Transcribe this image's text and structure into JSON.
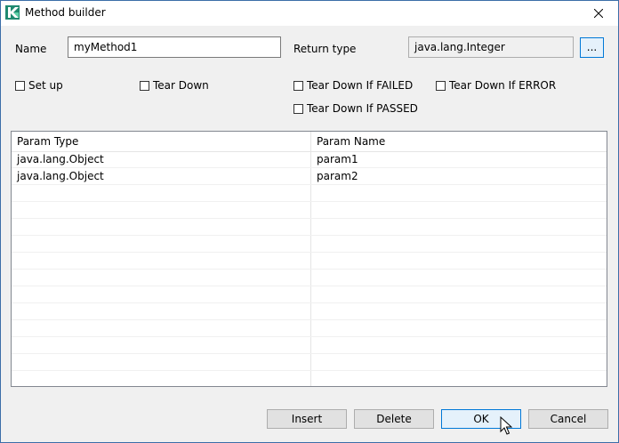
{
  "window": {
    "title": "Method builder"
  },
  "form": {
    "name_label": "Name",
    "name_value": "myMethod1",
    "return_label": "Return type",
    "return_value": "java.lang.Integer",
    "browse_label": "..."
  },
  "checkboxes": [
    {
      "label": "Set up",
      "checked": false
    },
    {
      "label": "Tear Down",
      "checked": false
    },
    {
      "label": "Tear Down If FAILED",
      "checked": false
    },
    {
      "label": "Tear Down If ERROR",
      "checked": false
    },
    {
      "label": "Tear Down If PASSED",
      "checked": false
    }
  ],
  "table": {
    "headers": [
      "Param Type",
      "Param Name"
    ],
    "rows": [
      [
        "java.lang.Object",
        "param1"
      ],
      [
        "java.lang.Object",
        "param2"
      ]
    ]
  },
  "buttons": {
    "insert": "Insert",
    "delete": "Delete",
    "ok": "OK",
    "cancel": "Cancel"
  },
  "colors": {
    "accent": "#0078d7",
    "logo_green": "#1fa37a"
  }
}
